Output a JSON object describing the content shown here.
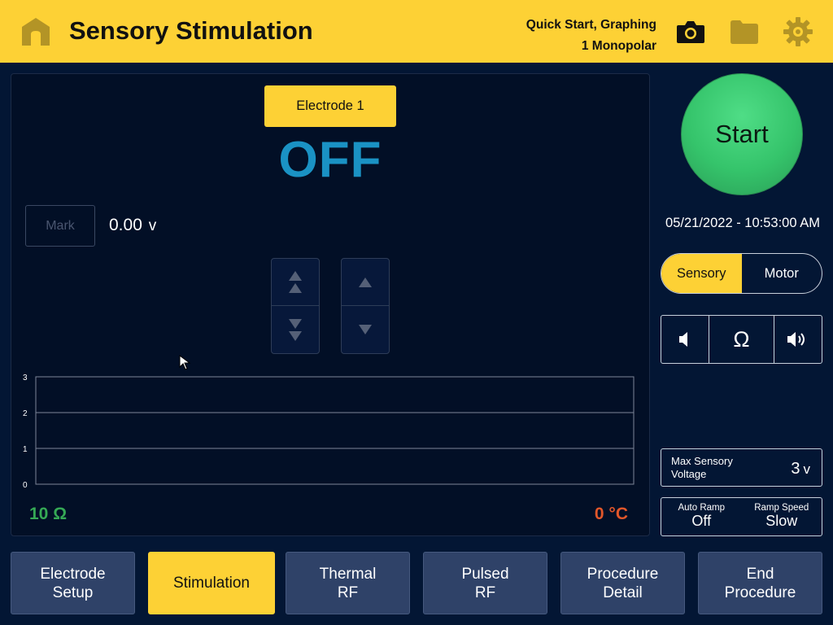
{
  "header": {
    "title": "Sensory Stimulation",
    "mode_line1": "Quick Start, Graphing",
    "mode_line2": "1 Monopolar",
    "icons": [
      "home-icon",
      "camera-icon",
      "folder-icon",
      "gear-icon"
    ]
  },
  "panel": {
    "electrode_label": "Electrode 1",
    "state": "OFF",
    "mark_label": "Mark",
    "voltage_value": "0.00",
    "voltage_unit": "v",
    "impedance": "10 Ω",
    "temperature": "0 °C"
  },
  "chart_data": {
    "type": "line",
    "series": [],
    "x": [],
    "ylim": [
      0,
      3
    ],
    "yticks": [
      "0",
      "1",
      "2",
      "3"
    ],
    "grid": true
  },
  "controls": {
    "start_label": "Start",
    "datetime": "05/21/2022 - 10:53:00 AM",
    "mode_toggle": {
      "options": [
        "Sensory",
        "Motor"
      ],
      "selected": "Sensory"
    },
    "audio": {
      "volume_down_icon": "speaker-low-icon",
      "impedance_symbol": "Ω",
      "volume_up_icon": "speaker-high-icon"
    },
    "max_voltage": {
      "label": "Max Sensory Voltage",
      "value": "3",
      "unit": "v"
    },
    "ramp": {
      "auto_ramp_label": "Auto Ramp",
      "auto_ramp_value": "Off",
      "ramp_speed_label": "Ramp Speed",
      "ramp_speed_value": "Slow"
    }
  },
  "nav": {
    "items": [
      {
        "line1": "Electrode",
        "line2": "Setup"
      },
      {
        "line1": "Stimulation",
        "line2": ""
      },
      {
        "line1": "Thermal",
        "line2": "RF"
      },
      {
        "line1": "Pulsed",
        "line2": "RF"
      },
      {
        "line1": "Procedure",
        "line2": "Detail"
      },
      {
        "line1": "End",
        "line2": "Procedure"
      }
    ],
    "active": "Stimulation"
  },
  "colors": {
    "accent": "#fdd135",
    "background": "#031634",
    "state_off": "#1a92c4",
    "impedance": "#35a955",
    "temperature": "#e2572a",
    "start": "#35c46b"
  }
}
